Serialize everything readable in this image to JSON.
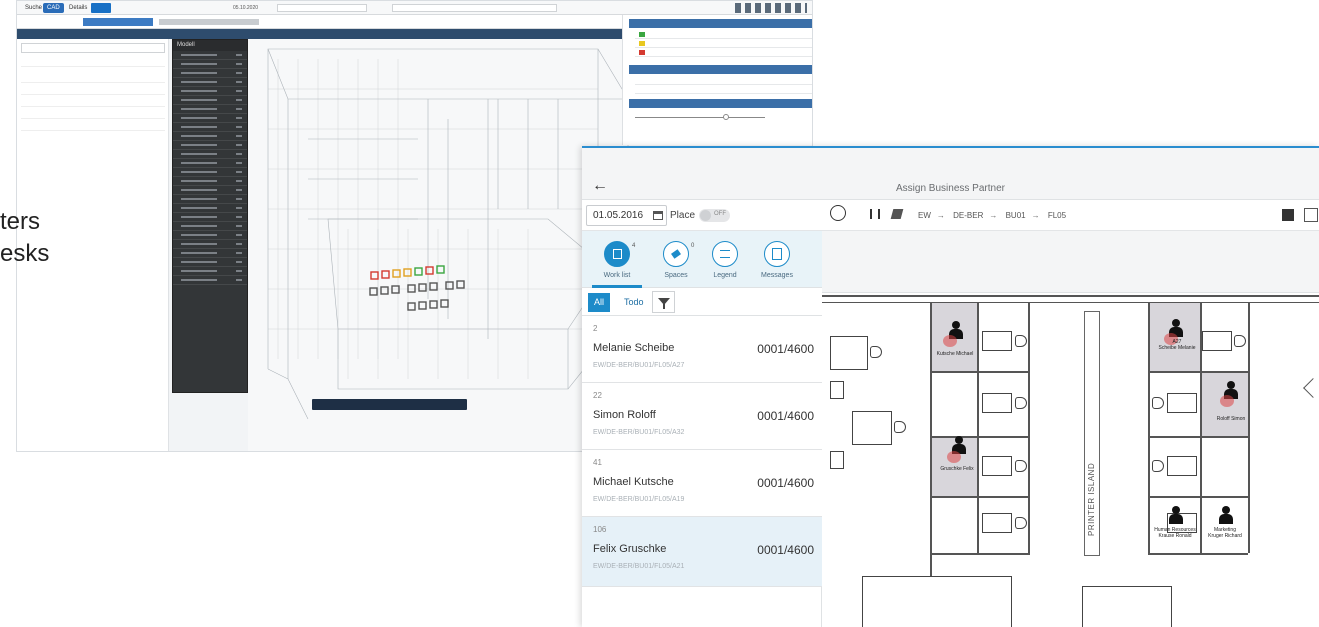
{
  "slide": {
    "line1": "ters",
    "line2": "esks"
  },
  "back_window": {
    "tabs": [
      "Suche",
      "CAD",
      "Details"
    ],
    "date": "05.10.2020",
    "model_title": "Modell"
  },
  "front_window": {
    "title": "Assign Business Partner",
    "date": "01.05.2016",
    "place_label": "Place",
    "toggle_state": "OFF",
    "breadcrumb": [
      "EW",
      "DE-BER",
      "BU01",
      "FL05"
    ],
    "icons": [
      {
        "label": "Work list",
        "badge": "4",
        "icon": "list-icon"
      },
      {
        "label": "Spaces",
        "badge": "0",
        "icon": "share-icon"
      },
      {
        "label": "Legend",
        "badge": "",
        "icon": "legend-icon"
      },
      {
        "label": "Messages",
        "badge": "",
        "icon": "message-icon"
      }
    ],
    "tabs": {
      "all": "All",
      "todo": "Todo"
    },
    "worklist": [
      {
        "num": "2",
        "name": "Melanie Scheibe",
        "code": "0001/4600",
        "path": "EW/DE-BER/BU01/FL05/A27"
      },
      {
        "num": "22",
        "name": "Simon Roloff",
        "code": "0001/4600",
        "path": "EW/DE-BER/BU01/FL05/A32"
      },
      {
        "num": "41",
        "name": "Michael Kutsche",
        "code": "0001/4600",
        "path": "EW/DE-BER/BU01/FL05/A19"
      },
      {
        "num": "106",
        "name": "Felix Gruschke",
        "code": "0001/4600",
        "path": "EW/DE-BER/BU01/FL05/A21"
      }
    ],
    "printer_island": "PRINTER ISLAND",
    "floor_labels": {
      "a1": "Kutsche Michael",
      "a2": "A27\nScheibe Melanie",
      "a3": "Roloff Simon",
      "a4": "Gruschke Felix",
      "a5": "Human Resources\nKrause Ronald",
      "a6": "Marketing\nKruger Richard"
    },
    "colors": {
      "accent": "#1d8bc9",
      "selected": "#e6f1f8"
    }
  }
}
